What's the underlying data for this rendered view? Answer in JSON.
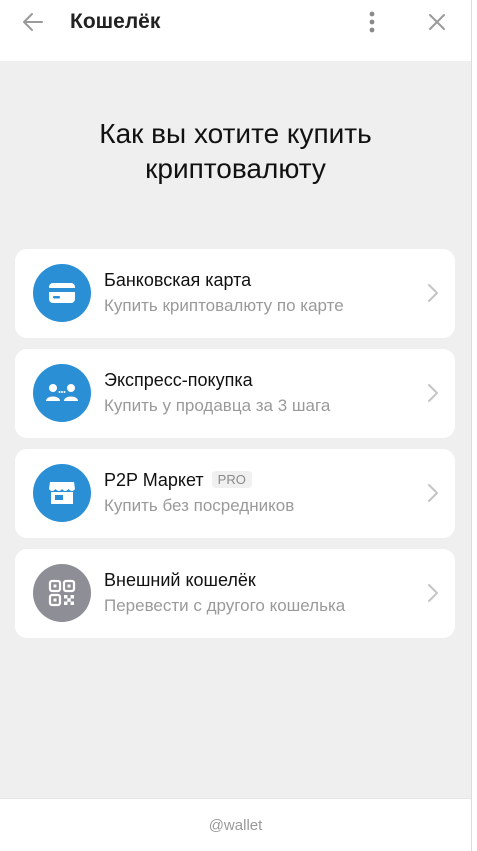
{
  "header": {
    "title": "Кошелёк",
    "back_icon": "arrow-left-icon",
    "menu_icon": "more-vertical-icon",
    "close_icon": "close-icon"
  },
  "heading": {
    "line1": "Как вы хотите купить",
    "line2": "криптовалюту"
  },
  "options": [
    {
      "icon": "credit-card-icon",
      "label": "Банковская карта",
      "sub": "Купить криптовалюту по карте",
      "icon_color": "#2b8fd6"
    },
    {
      "icon": "people-exchange-icon",
      "label": "Экспресс-покупка",
      "sub": "Купить у продавца за 3 шага",
      "icon_color": "#2b8fd6"
    },
    {
      "icon": "storefront-icon",
      "label": "P2P Маркет",
      "badge": "PRO",
      "sub": "Купить без посредников",
      "icon_color": "#2b8fd6"
    },
    {
      "icon": "qr-code-icon",
      "label": "Внешний кошелёк",
      "sub": "Перевести с другого кошелька",
      "icon_color": "#8e8f96"
    }
  ],
  "footer": {
    "text": "@wallet"
  }
}
